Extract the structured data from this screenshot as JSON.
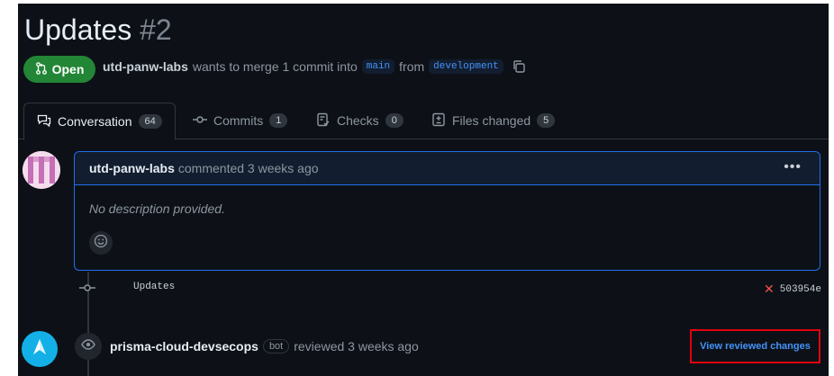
{
  "pr": {
    "title": "Updates",
    "number": "#2",
    "state": "Open",
    "author": "utd-panw-labs",
    "merge_text": "wants to merge 1 commit into",
    "base_branch": "main",
    "from_text": "from",
    "head_branch": "development"
  },
  "tabs": [
    {
      "label": "Conversation",
      "count": "64",
      "icon": "comment-discussion-icon"
    },
    {
      "label": "Commits",
      "count": "1",
      "icon": "git-commit-icon"
    },
    {
      "label": "Checks",
      "count": "0",
      "icon": "checklist-icon"
    },
    {
      "label": "Files changed",
      "count": "5",
      "icon": "file-diff-icon"
    }
  ],
  "comment": {
    "author": "utd-panw-labs",
    "meta": "commented 3 weeks ago",
    "body": "No description provided.",
    "more": "•••"
  },
  "commit": {
    "message": "Updates",
    "status": "✕",
    "sha": "503954e"
  },
  "review": {
    "author": "prisma-cloud-devsecops",
    "bot_label": "bot",
    "meta": "reviewed 3 weeks ago",
    "link": "View reviewed changes"
  },
  "colors": {
    "background": "#0d1117",
    "open_green": "#238636",
    "link_blue": "#4493f8",
    "highlight_red": "#e3000f",
    "failure_red": "#f85149"
  }
}
